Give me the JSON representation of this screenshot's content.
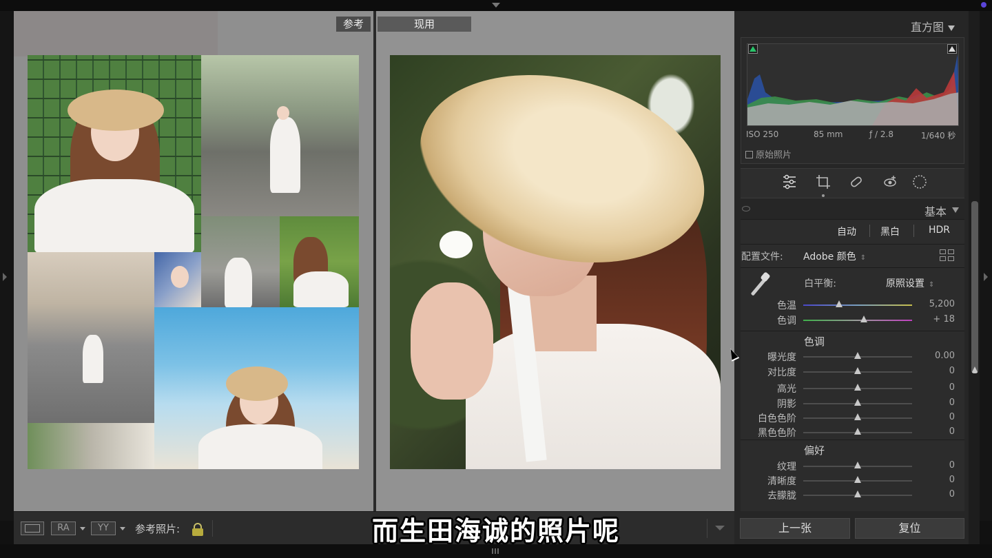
{
  "compare": {
    "reference_label": "参考",
    "current_label": "现用"
  },
  "toolbar": {
    "view_ra": "RA",
    "view_yy": "YY",
    "reference_photo_label": "参考照片:"
  },
  "subtitle": "而生田海诚的照片呢",
  "histogram": {
    "title": "直方图",
    "iso": "ISO 250",
    "focal": "85 mm",
    "aperture": "ƒ / 2.8",
    "shutter": "1/640 秒",
    "original_photo": "原始照片"
  },
  "basic": {
    "title": "基本",
    "auto": "自动",
    "bw": "黑白",
    "hdr": "HDR",
    "profile_label": "配置文件:",
    "profile_value": "Adobe 颜色",
    "wb_label": "白平衡:",
    "wb_value": "原照设置",
    "temp_label": "色温",
    "temp_value": "5,200",
    "tint_label": "色调",
    "tint_value": "+ 18",
    "tone_heading": "色调",
    "exposure_label": "曝光度",
    "exposure_value": "0.00",
    "contrast_label": "对比度",
    "contrast_value": "0",
    "highlights_label": "高光",
    "highlights_value": "0",
    "shadows_label": "阴影",
    "shadows_value": "0",
    "whites_label": "白色色阶",
    "whites_value": "0",
    "blacks_label": "黑色色阶",
    "blacks_value": "0",
    "presence_heading": "偏好",
    "texture_label": "纹理",
    "texture_value": "0",
    "clarity_label": "清晰度",
    "clarity_value": "0",
    "dehaze_label": "去朦胧",
    "dehaze_value": "0"
  },
  "sliders": {
    "temp": 0.33,
    "tint": 0.56,
    "exposure": 0.5,
    "contrast": 0.5,
    "highlights": 0.5,
    "shadows": 0.5,
    "whites": 0.5,
    "blacks": 0.5,
    "texture": 0.5,
    "clarity": 0.5,
    "dehaze": 0.5
  },
  "footer": {
    "prev": "上一张",
    "reset": "复位"
  },
  "colors": {
    "accent_green": "#29c46a",
    "panel_bg": "#262626",
    "compare_bg": "#8f8f8f"
  },
  "icons": [
    "sliders-icon",
    "crop-icon",
    "heal-icon",
    "redeye-icon",
    "mask-icon",
    "eyedropper-icon",
    "lock-icon"
  ]
}
